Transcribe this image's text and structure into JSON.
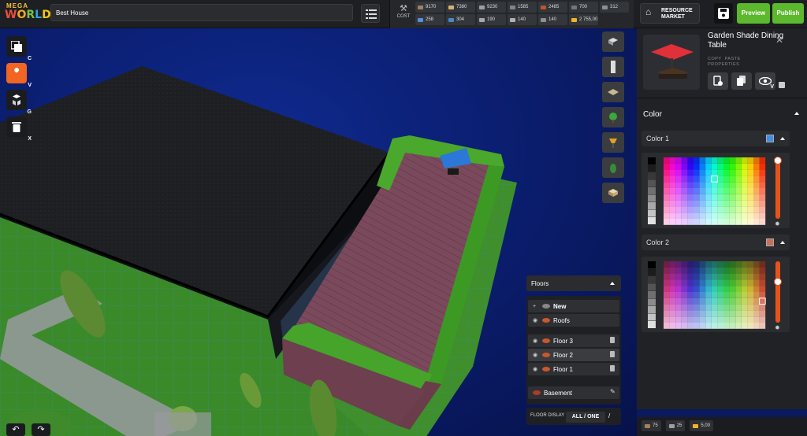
{
  "app": {
    "logo_top": "MEGA",
    "logo_letters": [
      "W",
      "O",
      "R",
      "L",
      "D"
    ],
    "project_name": "Best House"
  },
  "cost": {
    "label": "COST",
    "resources": [
      {
        "value": "9170",
        "color": "#a08060",
        "icon": "plank-icon"
      },
      {
        "value": "7380",
        "color": "#d8b070",
        "icon": "sand-icon"
      },
      {
        "value": "9230",
        "color": "#9aa0a8",
        "icon": "stone-icon"
      },
      {
        "value": "1585",
        "color": "#7f858c",
        "icon": "metal-icon"
      },
      {
        "value": "2485",
        "color": "#c0542c",
        "icon": "brick-icon"
      },
      {
        "value": "700",
        "color": "#6f7880",
        "icon": "steel-icon"
      },
      {
        "value": "312",
        "color": "#8c8f95",
        "icon": "concrete-icon"
      },
      {
        "value": "258",
        "color": "#5b8ed8",
        "icon": "glass-icon"
      },
      {
        "value": "304",
        "color": "#4a88c8",
        "icon": "water-icon"
      },
      {
        "value": "190",
        "color": "#a8a8a8",
        "icon": "ingot-icon"
      },
      {
        "value": "140",
        "color": "#b0b0b0",
        "icon": "pipe-icon"
      },
      {
        "value": "140",
        "color": "#909090",
        "icon": "cable-icon"
      },
      {
        "value": "2 755,00",
        "color": "#f0b429",
        "icon": "coin-icon"
      }
    ]
  },
  "toolbar": {
    "market_line1": "RESOURCE",
    "market_line2": "MARKET",
    "preview": "Preview",
    "publish": "Publish"
  },
  "tools": [
    {
      "name": "copy-tool",
      "key": "C",
      "active": false
    },
    {
      "name": "wrench-tool",
      "key": "V",
      "active": true
    },
    {
      "name": "group-tool",
      "key": "G",
      "active": false
    },
    {
      "name": "delete-tool",
      "key": "X",
      "active": false
    }
  ],
  "panel": {
    "title": "Garden Shade Dining Table",
    "links": [
      "COPY",
      "PASTE",
      "PROPERTIES"
    ],
    "visibility_key": "V",
    "color_section": "Color",
    "color1": {
      "label": "Color 1",
      "swatch": "#3d8fe8"
    },
    "color2": {
      "label": "Color 2",
      "swatch": "#c9705a"
    }
  },
  "floors": {
    "title": "Floors",
    "new_label": "New",
    "roofs_label": "Roofs",
    "items": [
      "Floor 3",
      "Floor 2",
      "Floor 1"
    ],
    "basement_label": "Basement",
    "display_label": "FLOOR DISLAY",
    "display_value": "ALL / ONE",
    "display_slash": "/"
  },
  "totals": [
    {
      "value": "75",
      "color": "#a08060"
    },
    {
      "value": "25",
      "color": "#9aa0a8"
    },
    {
      "value": "5,00",
      "color": "#f0b429"
    }
  ]
}
